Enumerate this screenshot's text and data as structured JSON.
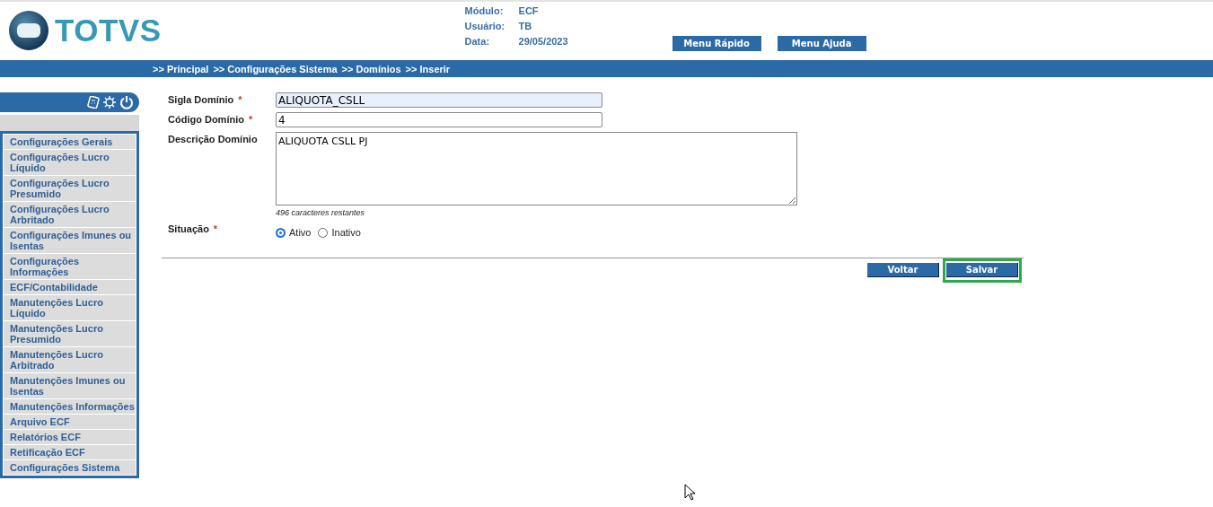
{
  "header": {
    "logo": "TOTVS",
    "info": [
      {
        "label": "Módulo:",
        "value": "ECF"
      },
      {
        "label": "Usuário:",
        "value": "TB"
      },
      {
        "label": "Data:",
        "value": "29/05/2023"
      }
    ],
    "buttons": [
      "Menu Rápido",
      "Menu Ajuda"
    ]
  },
  "breadcrumb": [
    ">> Principal",
    ">> Configurações Sistema",
    ">> Domínios",
    ">> Inserir"
  ],
  "sidebar": {
    "items": [
      {
        "label": "Configurações Gerais"
      },
      {
        "label": "Configurações Lucro Líquido"
      },
      {
        "label": "Configurações Lucro Presumido"
      },
      {
        "label": "Configurações Lucro Arbritado"
      },
      {
        "label": "Configurações Imunes ou Isentas"
      },
      {
        "label": "Configurações Informações"
      },
      {
        "label": "ECF/Contabilidade"
      },
      {
        "label": "Manutenções Lucro Líquido"
      },
      {
        "label": "Manutenções Lucro Presumido"
      },
      {
        "label": "Manutenções Lucro Arbitrado"
      },
      {
        "label": "Manutenções Imunes ou Isentas"
      },
      {
        "label": "Manutenções Informações"
      },
      {
        "label": "Arquivo ECF"
      },
      {
        "label": "Relatórios ECF"
      },
      {
        "label": "Retificação ECF"
      },
      {
        "label": "Configurações Sistema"
      }
    ]
  },
  "form": {
    "fields": [
      {
        "kind": "input",
        "label": "Sigla Domínio",
        "required_mark": "*",
        "value": "ALIQUOTA_CSLL",
        "focused": true
      },
      {
        "kind": "input",
        "label": "Código Domínio",
        "required_mark": "*",
        "value": "4",
        "focused": false
      },
      {
        "kind": "textarea",
        "label": "Descrição Domínio",
        "value": "ALIQUOTA CSLL PJ",
        "hint": "496 caracteres restantes"
      },
      {
        "kind": "radio",
        "label": "Situação",
        "required_mark": "*",
        "options": [
          {
            "label": "Ativo",
            "selected": true
          },
          {
            "label": "Inativo",
            "selected": false
          }
        ]
      }
    ],
    "buttons": [
      {
        "label": "Voltar",
        "highlighted": false
      },
      {
        "label": "Salvar",
        "highlighted": true
      }
    ]
  }
}
